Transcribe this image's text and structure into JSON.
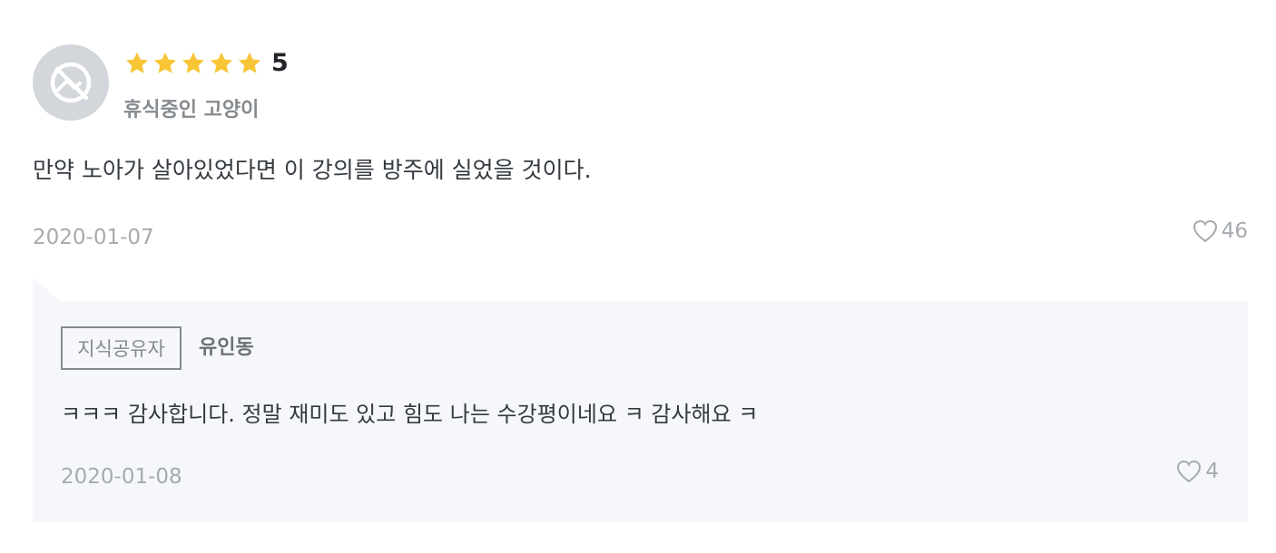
{
  "review": {
    "avatar_icon": "no-image-icon",
    "rating_value": "5",
    "stars_filled": 5,
    "star_color": "#f7c536",
    "username": "휴식중인 고양이",
    "body": "만약 노아가 살아있었다면 이 강의를 방주에 실었을 것이다.",
    "date": "2020-01-07",
    "like_icon": "heart-icon",
    "like_count": "46"
  },
  "reply": {
    "badge": "지식공유자",
    "author": "유인동",
    "body": "ㅋㅋㅋ 감사합니다. 정말 재미도 있고 힘도 나는 수강평이네요 ㅋ 감사해요 ㅋ",
    "date": "2020-01-08",
    "like_icon": "heart-icon",
    "like_count": "4"
  }
}
